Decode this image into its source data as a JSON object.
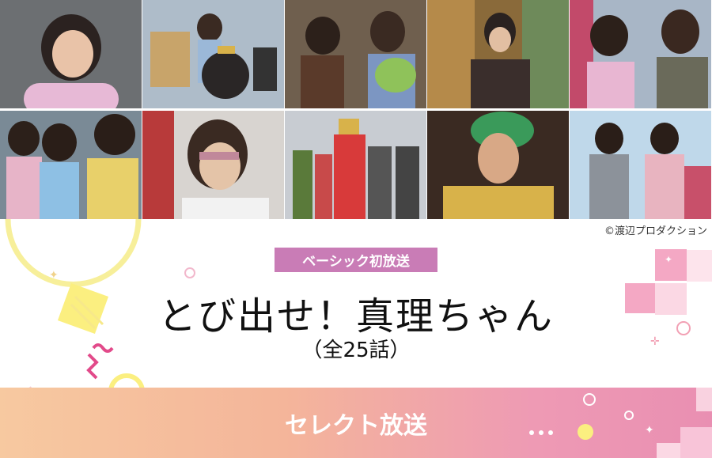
{
  "copyright": "©渡辺プロダクション",
  "badge": "ベーシック初放送",
  "title": "とび出せ！真理ちゃん",
  "subtitle": "（全25話）",
  "band_label": "セレクト放送"
}
